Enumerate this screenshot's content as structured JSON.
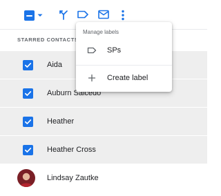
{
  "toolbar": {
    "icons": [
      "select-all-checkbox",
      "caret-down-icon",
      "merge-icon",
      "label-icon",
      "email-icon",
      "more-vert-icon"
    ],
    "accent_color": "#1a73e8"
  },
  "section": {
    "header": "STARRED CONTACTS"
  },
  "contacts": [
    {
      "name": "Aida",
      "selected": true
    },
    {
      "name": "Auburn Salcedo",
      "selected": true
    },
    {
      "name": "Heather",
      "selected": true
    },
    {
      "name": "Heather Cross",
      "selected": true
    },
    {
      "name": "Lindsay Zautke",
      "selected": false,
      "has_avatar": true
    }
  ],
  "label_menu": {
    "title": "Manage labels",
    "items": [
      {
        "label": "SPs",
        "icon": "label-outline-icon"
      }
    ],
    "create": {
      "label": "Create label",
      "icon": "plus-icon"
    }
  }
}
